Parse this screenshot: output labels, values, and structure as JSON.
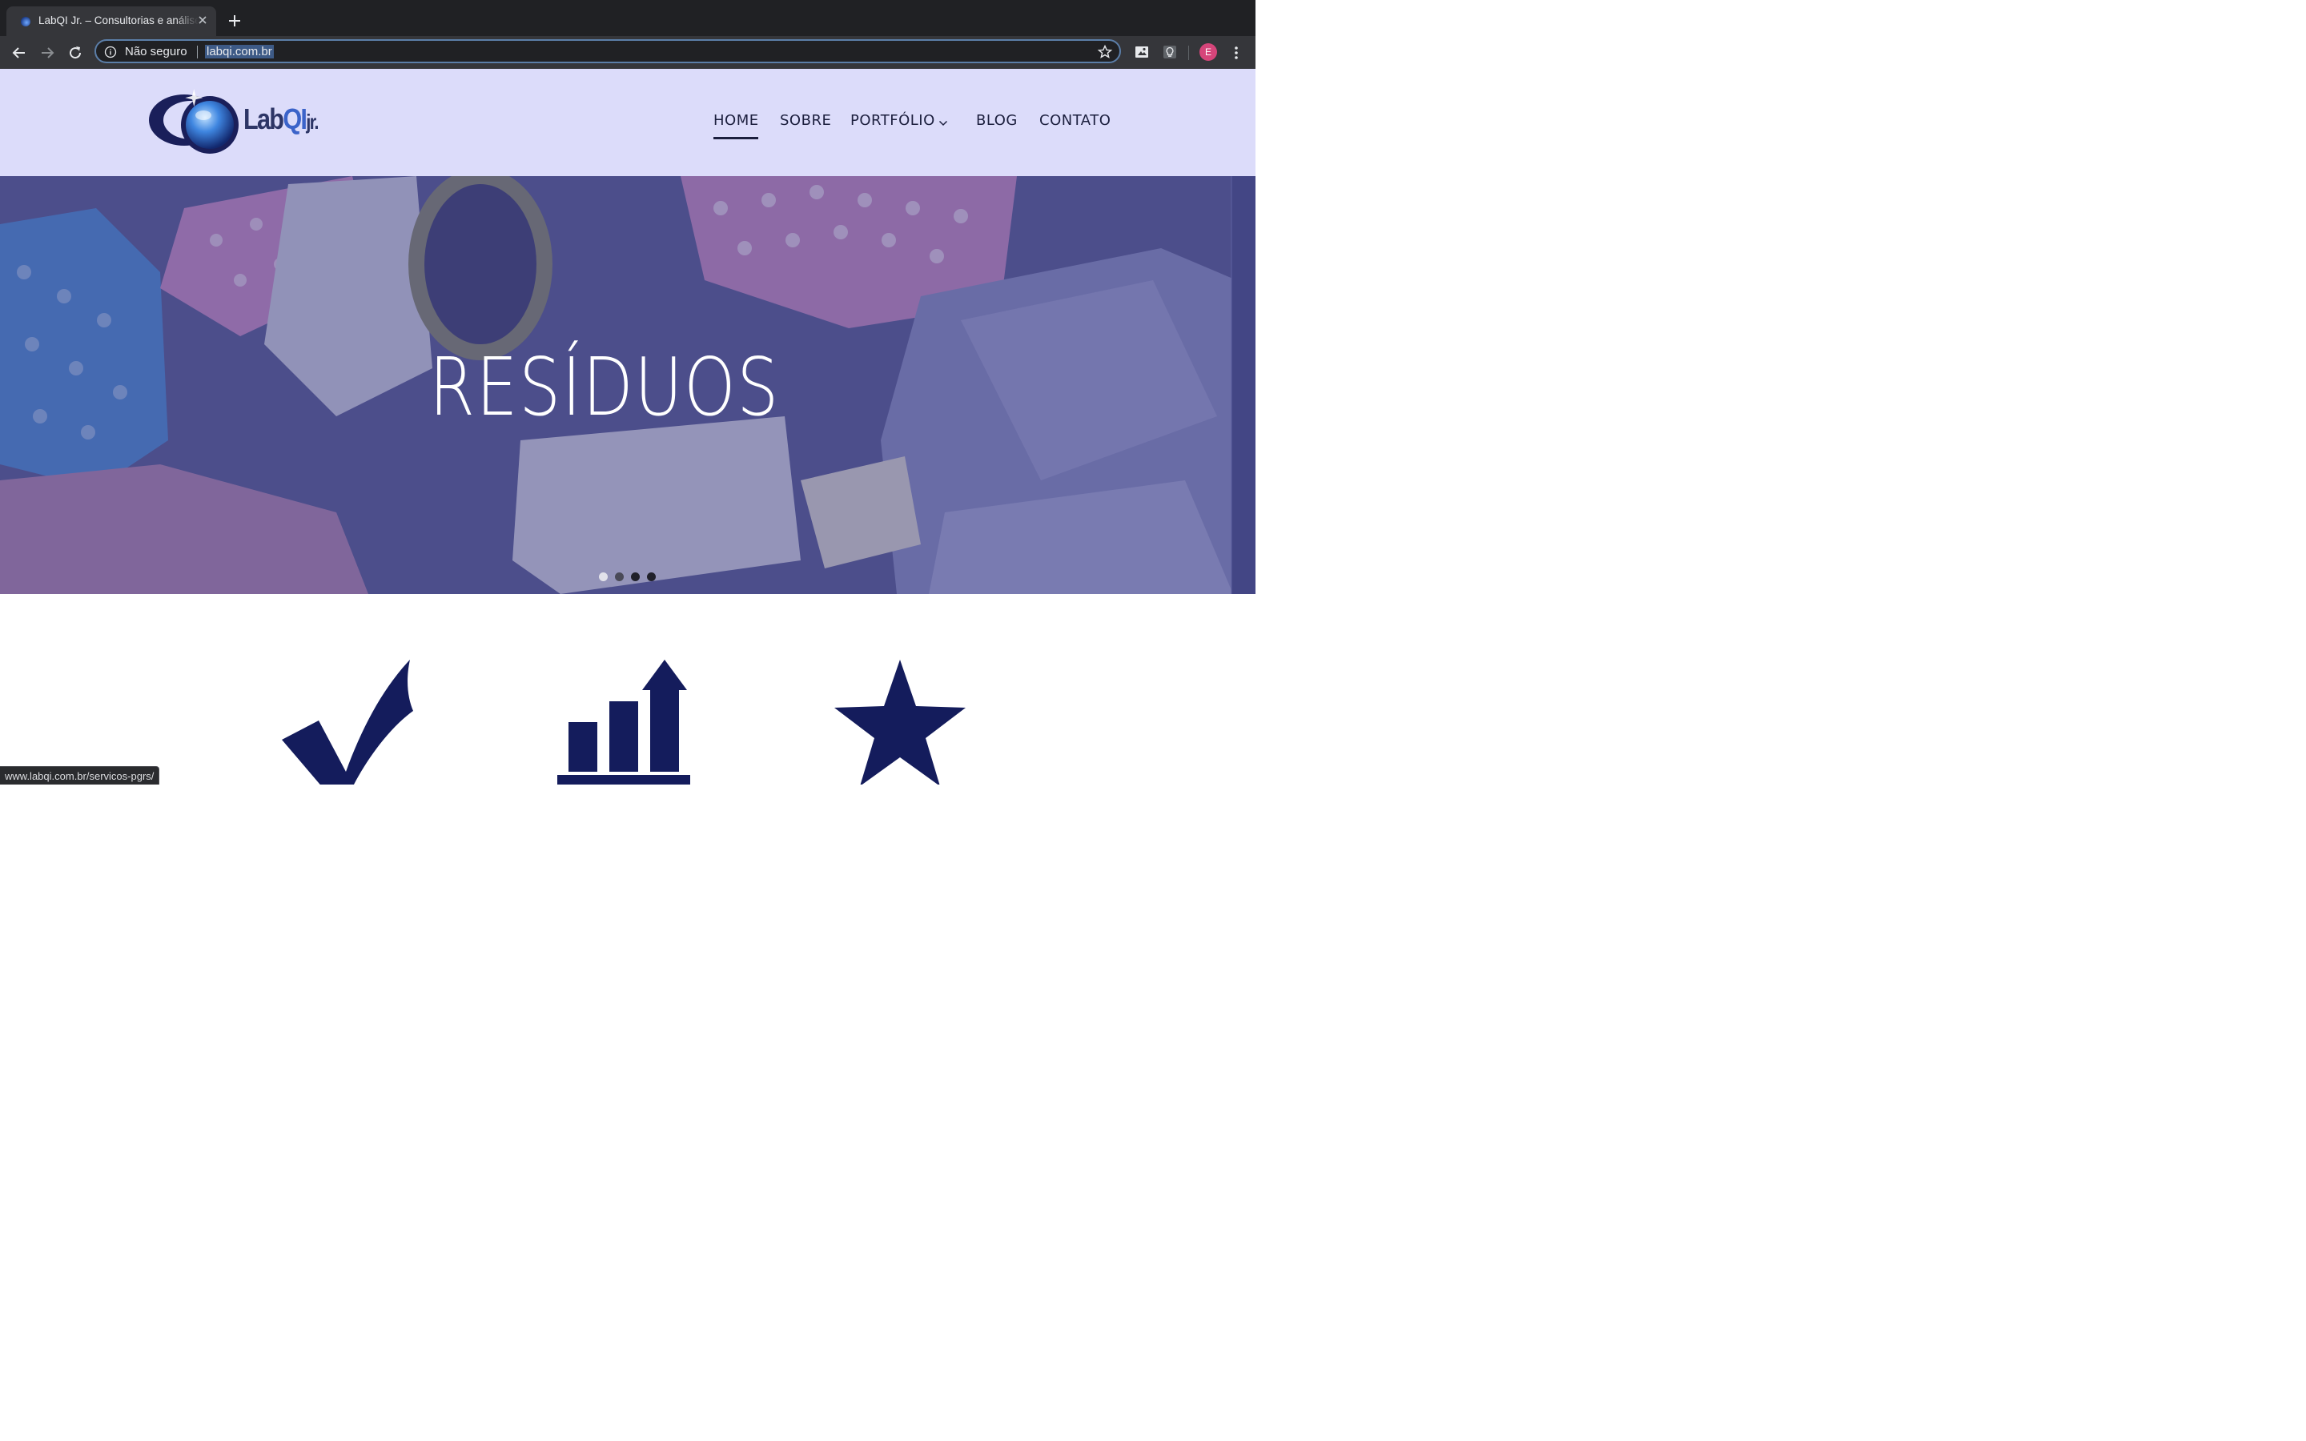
{
  "browser": {
    "tab_title": "LabQI Jr. – Consultorias e análises",
    "security_label": "Não seguro",
    "url": "labqi.com.br",
    "profile_initial": "E",
    "status_url": "www.labqi.com.br/servicos-pgrs/"
  },
  "site": {
    "logo": {
      "lab": "Lab",
      "qi": "QI",
      "jr": "jr."
    },
    "nav": {
      "home": "HOME",
      "sobre": "SOBRE",
      "portfolio": "PORTFÓLIO",
      "blog": "BLOG",
      "contato": "CONTATO"
    },
    "hero": {
      "heading": "RESÍDUOS",
      "slides": 4,
      "active_slide": 1
    },
    "features": [
      "check-icon",
      "growth-chart-icon",
      "star-icon"
    ]
  },
  "colors": {
    "chrome_dark": "#202124",
    "chrome_toolbar": "#35363a",
    "header_bg": "#dcdcfa",
    "nav_text": "#1c1f3e",
    "brand_navy": "#141c5c",
    "hero_overlay": "#3c3e82"
  }
}
